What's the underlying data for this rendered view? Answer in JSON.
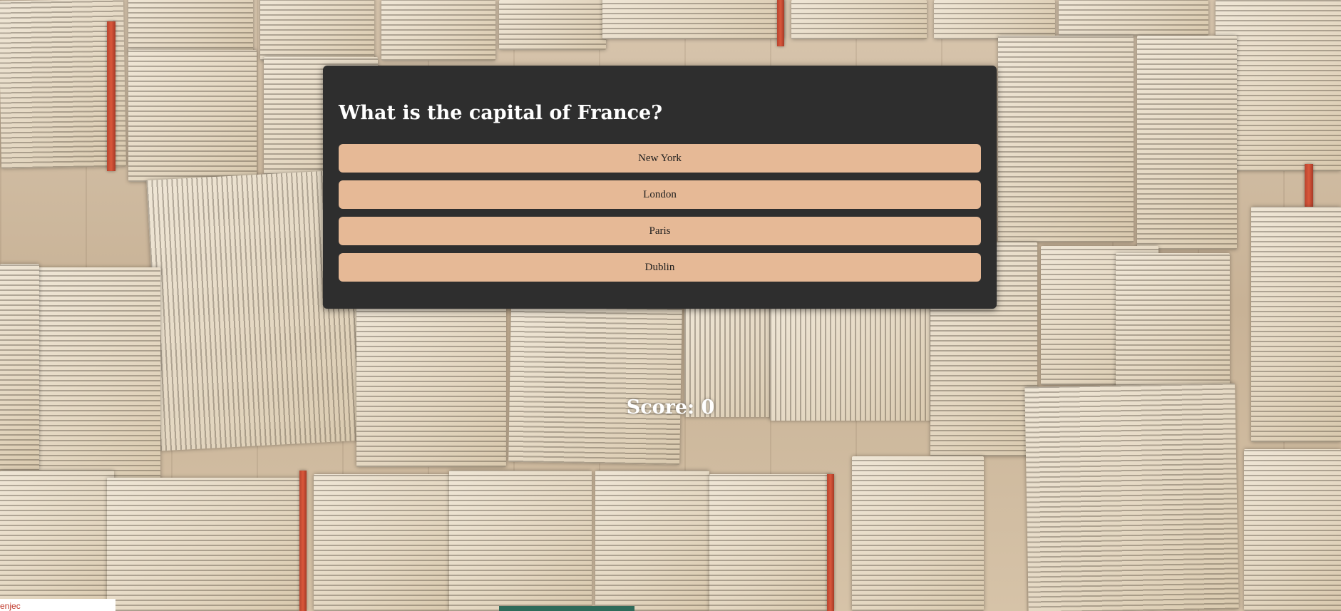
{
  "quiz": {
    "question": "What is the capital of France?",
    "answers": [
      "New York",
      "London",
      "Paris",
      "Dublin"
    ]
  },
  "score": {
    "text": "Score: 0"
  },
  "corner": {
    "text": "enjec"
  },
  "colors": {
    "card_background": "#2e2e2e",
    "answer_button": "#e6b996",
    "question_text": "#ffffff",
    "score_text": "#ffffff"
  }
}
